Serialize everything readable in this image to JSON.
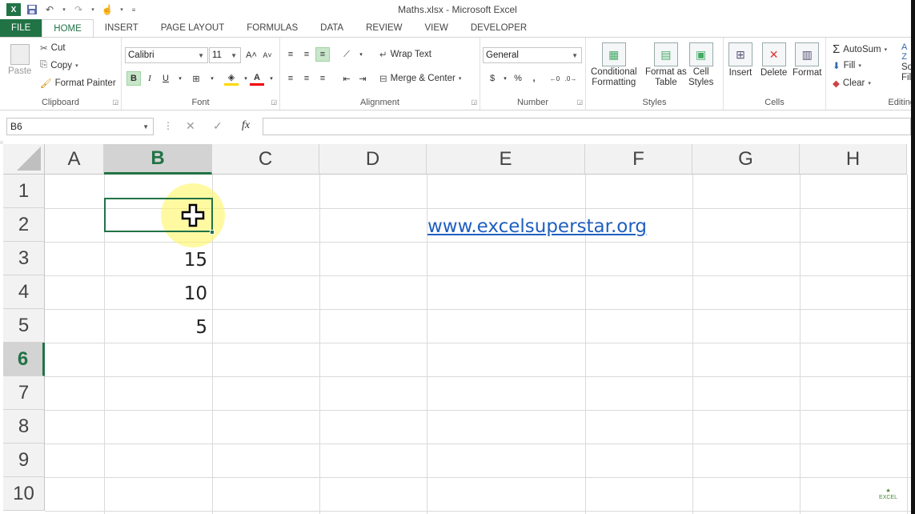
{
  "window": {
    "title": "Maths.xlsx - Microsoft Excel",
    "app_badge": "X"
  },
  "qat": {
    "save_icon": "save-icon",
    "undo_icon": "undo-icon",
    "redo_icon": "redo-icon",
    "touch_icon": "touch-mode-icon"
  },
  "tabs": [
    {
      "label": "FILE"
    },
    {
      "label": "HOME"
    },
    {
      "label": "INSERT"
    },
    {
      "label": "PAGE LAYOUT"
    },
    {
      "label": "FORMULAS"
    },
    {
      "label": "DATA"
    },
    {
      "label": "REVIEW"
    },
    {
      "label": "VIEW"
    },
    {
      "label": "DEVELOPER"
    }
  ],
  "ribbon": {
    "clipboard": {
      "paste": "Paste",
      "cut": "Cut",
      "copy": "Copy",
      "format_painter": "Format Painter",
      "label": "Clipboard"
    },
    "font": {
      "name": "Calibri",
      "size": "11",
      "bold": "B",
      "italic": "I",
      "underline": "U",
      "font_color": "A",
      "label": "Font"
    },
    "alignment": {
      "wrap": "Wrap Text",
      "merge": "Merge & Center",
      "label": "Alignment"
    },
    "number": {
      "format": "General",
      "currency": "$",
      "percent": "%",
      "comma": ",",
      "label": "Number"
    },
    "styles": {
      "conditional": "Conditional",
      "conditional2": "Formatting",
      "format_as": "Format as",
      "format_as2": "Table",
      "cell": "Cell",
      "cell2": "Styles",
      "label": "Styles"
    },
    "cells": {
      "insert": "Insert",
      "delete": "Delete",
      "format": "Format",
      "label": "Cells"
    },
    "editing": {
      "autosum": "AutoSum",
      "fill": "Fill",
      "clear": "Clear",
      "sort": "So",
      "sort2": "Fil",
      "label": "Editing"
    }
  },
  "formula_bar": {
    "name_box": "B6",
    "fx": "fx",
    "value": ""
  },
  "columns": [
    "A",
    "B",
    "C",
    "D",
    "E",
    "F",
    "G",
    "H"
  ],
  "rows": [
    "1",
    "2",
    "3",
    "4",
    "5",
    "6",
    "7",
    "8",
    "9",
    "10"
  ],
  "cells": {
    "E2": "www.excelsuperstar.org",
    "B3": "15",
    "B4": "10",
    "B5": "5"
  },
  "selected_cell": "B6",
  "watermark": "EXCEL",
  "colors": {
    "accent": "#217346",
    "link": "#1f5fbf"
  }
}
